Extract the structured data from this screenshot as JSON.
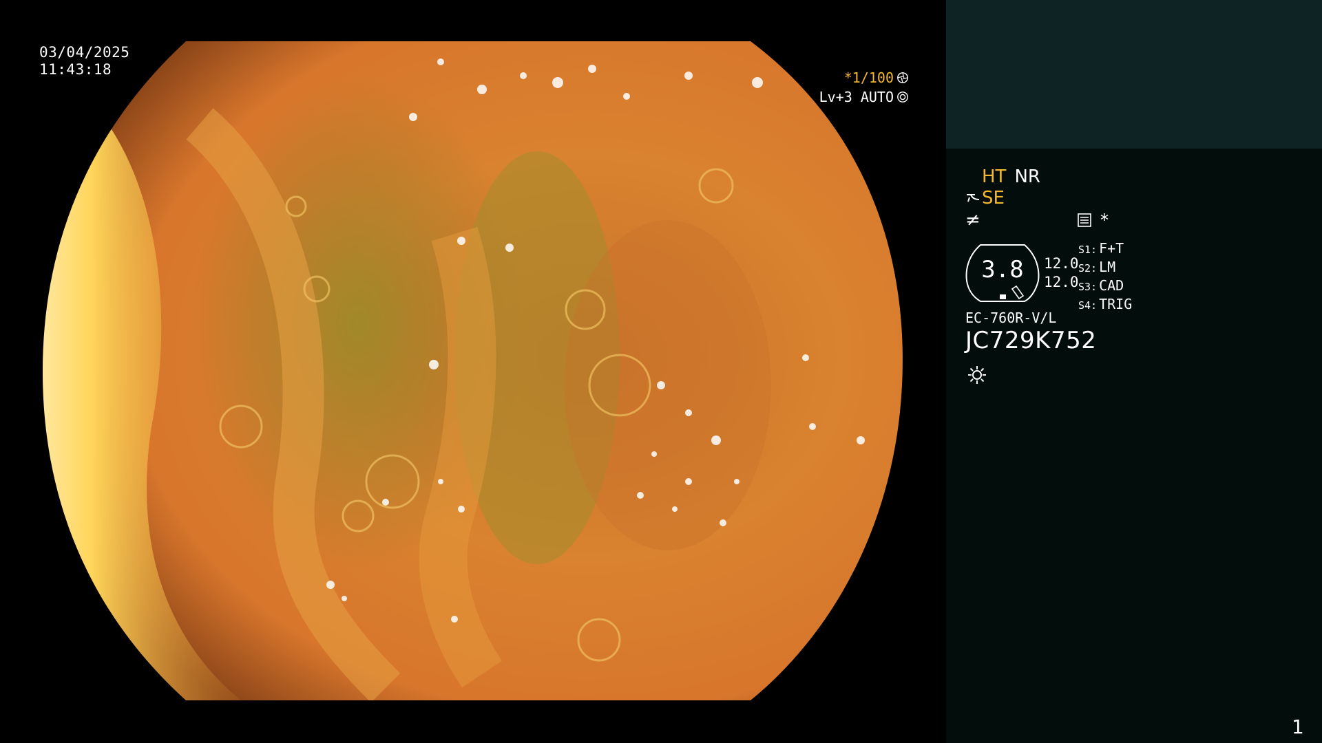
{
  "colors": {
    "accent": "#f5b82e",
    "panel_bg": "#020d0c",
    "panel_top_bg": "#0e2424"
  },
  "overlay": {
    "date": "03/04/2025",
    "time": "11:43:18",
    "shutter": "*1/100",
    "level": "Lv+3 AUTO"
  },
  "panel": {
    "ht": "HT",
    "nr": "NR",
    "se": "SE",
    "f_symbol": "≠",
    "gauge_value": "3.8",
    "gauge_num_1": "12.0",
    "gauge_num_2": "12.0",
    "switches": [
      {
        "key": "S1:",
        "value": "F+T"
      },
      {
        "key": "S2:",
        "value": "LM"
      },
      {
        "key": "S3:",
        "value": "CAD"
      },
      {
        "key": "S4:",
        "value": "TRIG"
      }
    ],
    "model": "EC-760R-V/L",
    "serial": "JC729K752",
    "page_number": "1"
  },
  "icons": {
    "shutter_icon": "aperture-icon",
    "level_icon": "target-icon",
    "se_icon": "scope-curve-icon",
    "mode_icon": "settings-list-icon",
    "light_icon": "sun-icon"
  }
}
